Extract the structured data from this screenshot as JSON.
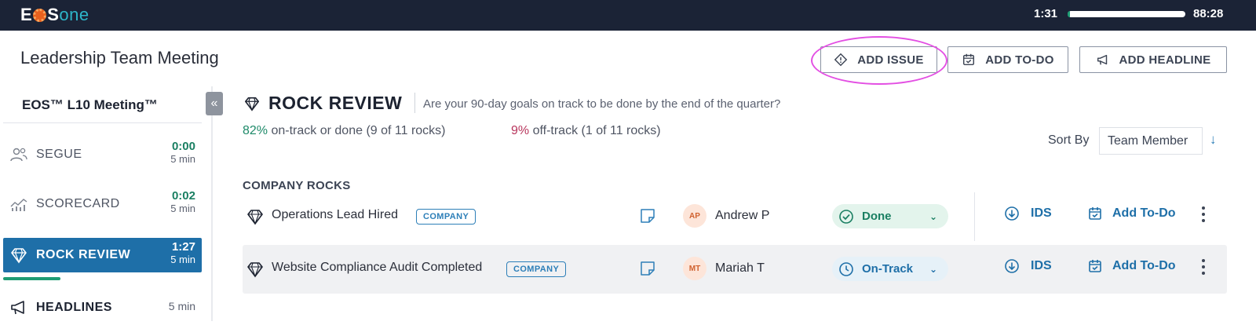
{
  "topbar": {
    "logo_e": "E",
    "logo_s": "S",
    "logo_one": "one",
    "elapsed": "1:31",
    "remaining": "88:28",
    "progress": 0.017
  },
  "meeting": {
    "title": "Leadership Team Meeting"
  },
  "header_buttons": {
    "add_issue": "ADD ISSUE",
    "add_todo": "ADD TO-DO",
    "add_headline": "ADD HEADLINE"
  },
  "sidebar": {
    "heading": "EOS™ L10 Meeting™",
    "collapse_glyph": "«",
    "items": [
      {
        "label": "SEGUE",
        "time": "0:00",
        "duration": "5 min"
      },
      {
        "label": "SCORECARD",
        "time": "0:02",
        "duration": "5 min"
      },
      {
        "label": "ROCK REVIEW",
        "time": "1:27",
        "duration": "5 min"
      },
      {
        "label": "HEADLINES",
        "duration": "5 min"
      }
    ]
  },
  "rock_review": {
    "title": "ROCK REVIEW",
    "subtitle": "Are your 90-day goals on track to be done by the end of the quarter?",
    "ontrack_pct": "82%",
    "ontrack_text": "on-track or done (9 of 11 rocks)",
    "offtrack_pct": "9%",
    "offtrack_text": "off-track (1 of 11 rocks)",
    "sort_label": "Sort By",
    "sort_value": "Team Member",
    "section": "COMPANY ROCKS",
    "rows": [
      {
        "name": "Operations Lead Hired",
        "badge": "COMPANY",
        "initials": "AP",
        "owner": "Andrew P",
        "status": "Done",
        "ids": "IDS",
        "todo": "Add To-Do"
      },
      {
        "name": "Website Compliance Audit Completed",
        "badge": "COMPANY",
        "initials": "MT",
        "owner": "Mariah T",
        "status": "On-Track",
        "ids": "IDS",
        "todo": "Add To-Do"
      }
    ]
  },
  "colors": {
    "accent": "#1e6fa8",
    "done": "#1a7f62",
    "offtrack": "#b8365d",
    "highlight": "#e34fe3",
    "topbar": "#1b2336"
  }
}
